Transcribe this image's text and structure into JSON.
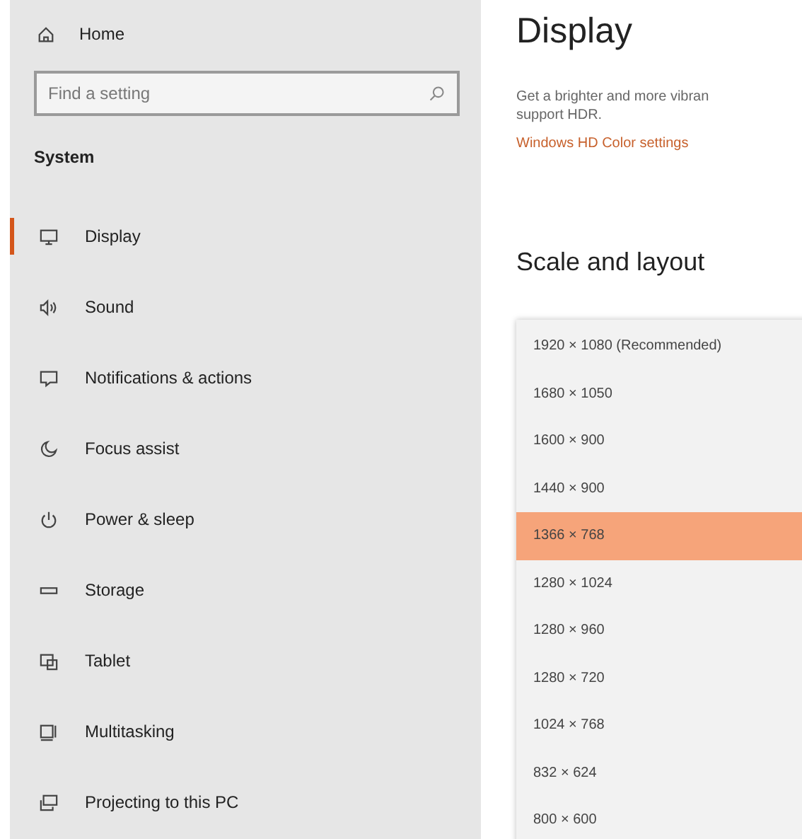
{
  "sidebar": {
    "home": "Home",
    "search": {
      "placeholder": "Find a setting"
    },
    "section": "System",
    "items": [
      {
        "label": "Display",
        "selected": true
      },
      {
        "label": "Sound",
        "selected": false
      },
      {
        "label": "Notifications & actions",
        "selected": false
      },
      {
        "label": "Focus assist",
        "selected": false
      },
      {
        "label": "Power & sleep",
        "selected": false
      },
      {
        "label": "Storage",
        "selected": false
      },
      {
        "label": "Tablet",
        "selected": false
      },
      {
        "label": "Multitasking",
        "selected": false
      },
      {
        "label": "Projecting to this PC",
        "selected": false
      }
    ]
  },
  "main": {
    "title": "Display",
    "description": "Get a brighter and more vibran",
    "description_2": "support HDR.",
    "link": "Windows HD Color settings",
    "section": "Scale and layout",
    "resolutions": [
      {
        "label": "1920 × 1080 (Recommended)",
        "selected": false
      },
      {
        "label": "1680 × 1050",
        "selected": false
      },
      {
        "label": "1600 × 900",
        "selected": false
      },
      {
        "label": "1440 × 900",
        "selected": false
      },
      {
        "label": "1366 × 768",
        "selected": true
      },
      {
        "label": "1280 × 1024",
        "selected": false
      },
      {
        "label": "1280 × 960",
        "selected": false
      },
      {
        "label": "1280 × 720",
        "selected": false
      },
      {
        "label": "1024 × 768",
        "selected": false
      },
      {
        "label": "832 × 624",
        "selected": false
      },
      {
        "label": "800 × 600",
        "selected": false
      }
    ]
  }
}
